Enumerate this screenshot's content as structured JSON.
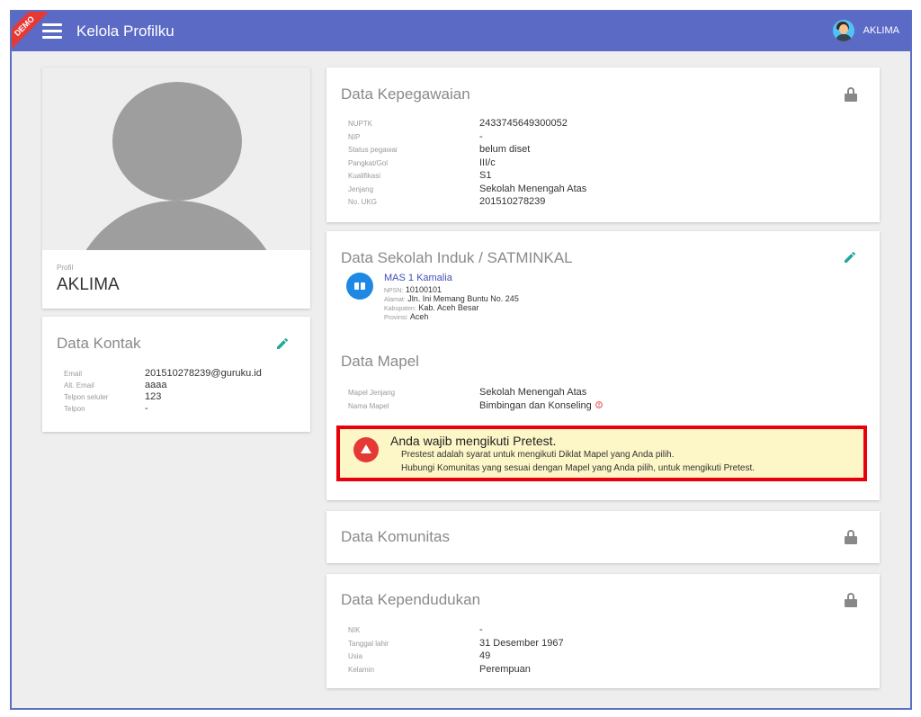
{
  "appbar": {
    "ribbon": "DEMO",
    "title": "Kelola Profilku",
    "user_name": "AKLIMA"
  },
  "profile": {
    "label": "Profil",
    "name": "AKLIMA"
  },
  "kontak": {
    "title": "Data Kontak",
    "rows": [
      {
        "k": "Email",
        "v": "201510278239@guruku.id"
      },
      {
        "k": "Alt. Email",
        "v": "aaaa"
      },
      {
        "k": "Telpon seluler",
        "v": "123"
      },
      {
        "k": "Telpon",
        "v": "-"
      }
    ]
  },
  "kepegawaian": {
    "title": "Data Kepegawaian",
    "rows": [
      {
        "k": "NUPTK",
        "v": "2433745649300052"
      },
      {
        "k": "NIP",
        "v": "-"
      },
      {
        "k": "Status pegawai",
        "v": "belum diset"
      },
      {
        "k": "Pangkat/Gol",
        "v": "III/c"
      },
      {
        "k": "Kualifikasi",
        "v": "S1"
      },
      {
        "k": "Jenjang",
        "v": "Sekolah Menengah Atas"
      },
      {
        "k": "No. UKG",
        "v": "201510278239"
      }
    ]
  },
  "sekolah": {
    "title": "Data Sekolah Induk / SATMINKAL",
    "school_name": "MAS 1 Kamalia",
    "npsn_label": "NPSN:",
    "npsn": "10100101",
    "alamat_label": "Alamat:",
    "alamat": "Jln. Ini Memang Buntu No. 245",
    "kabupaten_label": "Kabupaten:",
    "kabupaten": "Kab. Aceh Besar",
    "provinsi_label": "Provinsi:",
    "provinsi": "Aceh"
  },
  "mapel": {
    "title": "Data Mapel",
    "rows": [
      {
        "k": "Mapel Jenjang",
        "v": "Sekolah Menengah Atas"
      },
      {
        "k": "Nama Mapel",
        "v": "Bimbingan dan Konseling"
      }
    ]
  },
  "alert": {
    "title": "Anda wajib mengikuti Pretest.",
    "line1": "Prestest adalah syarat untuk mengikuti Diklat Mapel yang Anda pilih.",
    "line2": "Hubungi Komunitas yang sesuai dengan Mapel yang Anda pilih, untuk mengikuti Pretest."
  },
  "komunitas": {
    "title": "Data Komunitas"
  },
  "kependudukan": {
    "title": "Data Kependudukan",
    "rows": [
      {
        "k": "NIK",
        "v": "-"
      },
      {
        "k": "Tanggal lahir",
        "v": "31 Desember 1967"
      },
      {
        "k": "Usia",
        "v": "49"
      },
      {
        "k": "Kelamin",
        "v": "Perempuan"
      }
    ]
  },
  "colors": {
    "appbar": "#5b6bc5",
    "ribbon": "#e53935",
    "edit_icon": "#26a69a",
    "alert_border": "#e8000b",
    "alert_bg": "#fdf6c7",
    "school_icon": "#1e88e5"
  },
  "icons": {
    "menu": "hamburger-menu-icon",
    "avatar": "user-avatar-icon",
    "lock": "lock-icon",
    "edit": "pencil-icon",
    "warning": "warning-triangle-icon",
    "school": "school-book-icon",
    "info": "info-circle-icon"
  }
}
